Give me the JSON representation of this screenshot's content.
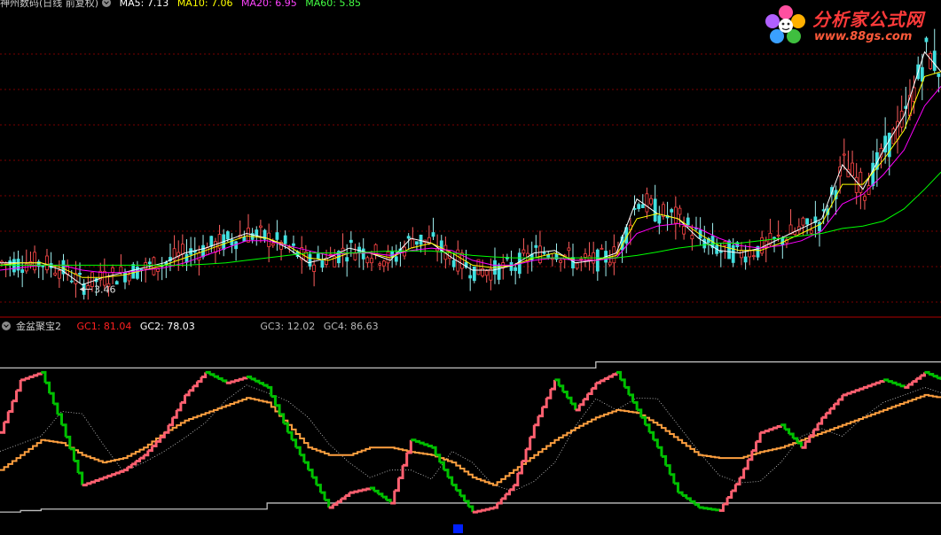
{
  "header_top": {
    "title": "神州数码(日线 前复权)",
    "ma": [
      {
        "label": "MA5: 7.13",
        "color": "#ffffff"
      },
      {
        "label": "MA10: 7.06",
        "color": "#ffff00"
      },
      {
        "label": "MA20: 6.95",
        "color": "#ff00ff"
      },
      {
        "label": "MA60: 5.85",
        "color": "#00ff00"
      }
    ]
  },
  "header_bottom": {
    "title": "金盆聚宝2",
    "gc": [
      {
        "label": "GC1: 81.04",
        "color": "#ff2020"
      },
      {
        "label": "GC2: 78.03",
        "color": "#ffffff"
      },
      {
        "label": "GC3: 12.02",
        "color": "#c0c0c0"
      },
      {
        "label": "GC4: 86.63",
        "color": "#c0c0c0"
      }
    ]
  },
  "logo": {
    "text": "分析家公式网",
    "url": "www.88gs.com"
  },
  "chart_data": [
    {
      "type": "line",
      "title": "神州数码(日线 前复权)",
      "ylim": [
        3.0,
        9.0
      ],
      "annotations": [
        {
          "text": "3.46",
          "x": 19,
          "y": 3.46
        }
      ],
      "x": [
        0,
        5,
        10,
        15,
        20,
        25,
        30,
        35,
        40,
        45,
        50,
        55,
        60,
        65,
        70,
        75,
        80,
        85,
        90,
        95,
        100,
        105,
        110,
        115,
        120,
        125,
        130,
        135,
        140,
        145,
        150,
        155,
        160,
        165,
        170,
        175,
        180,
        185,
        190,
        195,
        200,
        205,
        210,
        215,
        220,
        225,
        229
      ],
      "series": [
        {
          "name": "MA5",
          "color": "#ffffff",
          "values": [
            4.0,
            4.0,
            4.0,
            3.85,
            3.55,
            3.7,
            3.8,
            3.9,
            4.0,
            4.2,
            4.3,
            4.45,
            4.6,
            4.5,
            4.3,
            4.0,
            4.1,
            4.3,
            4.2,
            4.05,
            4.5,
            4.4,
            4.1,
            3.85,
            3.85,
            3.95,
            4.2,
            4.25,
            4.0,
            4.05,
            4.2,
            5.3,
            5.0,
            4.9,
            4.5,
            4.25,
            4.2,
            4.3,
            4.5,
            4.7,
            4.9,
            6.0,
            5.5,
            6.3,
            7.0,
            8.3,
            7.9
          ]
        },
        {
          "name": "MA10",
          "color": "#ffff00",
          "values": [
            3.95,
            4.0,
            4.0,
            3.9,
            3.7,
            3.7,
            3.75,
            3.85,
            3.95,
            4.1,
            4.25,
            4.4,
            4.55,
            4.5,
            4.35,
            4.1,
            4.05,
            4.2,
            4.2,
            4.1,
            4.3,
            4.4,
            4.2,
            3.95,
            3.9,
            3.95,
            4.1,
            4.2,
            4.05,
            4.05,
            4.15,
            4.9,
            5.0,
            4.9,
            4.6,
            4.35,
            4.25,
            4.25,
            4.4,
            4.6,
            4.8,
            5.6,
            5.6,
            6.1,
            6.7,
            7.8,
            7.9
          ]
        },
        {
          "name": "MA20",
          "color": "#ff00ff",
          "values": [
            3.85,
            3.9,
            3.95,
            3.95,
            3.85,
            3.8,
            3.8,
            3.85,
            3.9,
            4.0,
            4.15,
            4.3,
            4.45,
            4.45,
            4.35,
            4.25,
            4.15,
            4.2,
            4.2,
            4.15,
            4.25,
            4.3,
            4.25,
            4.05,
            3.95,
            3.95,
            4.05,
            4.1,
            4.05,
            4.05,
            4.1,
            4.6,
            4.75,
            4.8,
            4.7,
            4.5,
            4.35,
            4.3,
            4.35,
            4.45,
            4.65,
            5.2,
            5.4,
            5.8,
            6.3,
            7.2,
            7.6
          ]
        },
        {
          "name": "MA60",
          "color": "#00ff00",
          "values": [
            3.95,
            3.95,
            3.95,
            3.95,
            3.95,
            3.95,
            3.95,
            3.95,
            3.95,
            3.95,
            3.97,
            4.0,
            4.05,
            4.1,
            4.15,
            4.2,
            4.2,
            4.2,
            4.22,
            4.24,
            4.24,
            4.24,
            4.2,
            4.15,
            4.12,
            4.1,
            4.1,
            4.1,
            4.1,
            4.1,
            4.1,
            4.15,
            4.22,
            4.3,
            4.35,
            4.4,
            4.4,
            4.45,
            4.5,
            4.55,
            4.6,
            4.7,
            4.75,
            4.85,
            5.1,
            5.5,
            5.85
          ]
        }
      ]
    },
    {
      "type": "line",
      "title": "金盆聚宝2",
      "ylim": [
        -5,
        110
      ],
      "x": [
        0,
        5,
        10,
        15,
        20,
        25,
        30,
        35,
        40,
        45,
        50,
        55,
        60,
        65,
        70,
        75,
        80,
        85,
        90,
        95,
        100,
        105,
        110,
        115,
        120,
        125,
        130,
        135,
        140,
        145,
        150,
        155,
        160,
        165,
        170,
        175,
        180,
        185,
        190,
        195,
        200,
        205,
        210,
        215,
        220,
        225,
        229
      ],
      "series": [
        {
          "name": "GC1",
          "color": "#ff6070",
          "color_falling": "#00c000",
          "values": [
            55,
            90,
            95,
            60,
            20,
            25,
            30,
            40,
            55,
            80,
            95,
            88,
            92,
            85,
            55,
            30,
            5,
            15,
            18,
            8,
            50,
            45,
            20,
            2,
            5,
            20,
            60,
            90,
            70,
            88,
            95,
            70,
            45,
            15,
            5,
            3,
            25,
            55,
            60,
            45,
            65,
            80,
            85,
            90,
            85,
            95,
            90
          ]
        },
        {
          "name": "GC2",
          "color": "#ffa040",
          "values": [
            30,
            40,
            50,
            48,
            40,
            35,
            38,
            45,
            55,
            63,
            68,
            73,
            78,
            75,
            60,
            45,
            40,
            40,
            45,
            45,
            42,
            40,
            35,
            25,
            20,
            30,
            40,
            50,
            58,
            65,
            70,
            68,
            60,
            50,
            40,
            38,
            38,
            42,
            45,
            50,
            55,
            60,
            65,
            70,
            75,
            80,
            78
          ]
        },
        {
          "name": "GC3",
          "color": "#c0c0c0",
          "values": [
            2,
            3,
            4,
            4,
            4,
            4,
            4,
            4,
            4,
            4,
            4,
            4,
            4,
            8,
            8,
            8,
            8,
            8,
            8,
            8,
            8,
            8,
            8,
            8,
            8,
            8,
            8,
            8,
            8,
            8,
            8,
            8,
            8,
            8,
            8,
            8,
            8,
            8,
            8,
            8,
            8,
            8,
            8,
            8,
            8,
            8,
            8
          ]
        },
        {
          "name": "GC4",
          "color": "#c0c0c0",
          "values": [
            98,
            98,
            98,
            98,
            98,
            98,
            98,
            98,
            98,
            98,
            98,
            98,
            98,
            98,
            98,
            98,
            98,
            98,
            98,
            98,
            98,
            98,
            98,
            98,
            98,
            98,
            98,
            98,
            98,
            102,
            102,
            102,
            102,
            102,
            102,
            102,
            102,
            102,
            102,
            102,
            102,
            102,
            102,
            102,
            102,
            102,
            102
          ]
        }
      ]
    }
  ]
}
